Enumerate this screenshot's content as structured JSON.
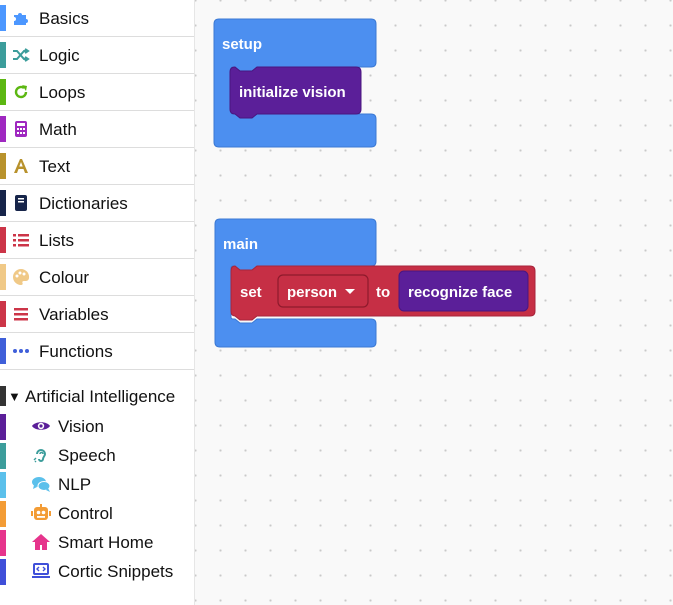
{
  "sidebar": {
    "categories": [
      {
        "label": "Basics",
        "icon": "puzzle-icon",
        "color": "#4c97ff"
      },
      {
        "label": "Logic",
        "icon": "shuffle-icon",
        "color": "#3c9d9b"
      },
      {
        "label": "Loops",
        "icon": "refresh-icon",
        "color": "#5cb712"
      },
      {
        "label": "Math",
        "icon": "calculator-icon",
        "color": "#9f28c0"
      },
      {
        "label": "Text",
        "icon": "font-icon",
        "color": "#b8922c"
      },
      {
        "label": "Dictionaries",
        "icon": "book-icon",
        "color": "#17254a"
      },
      {
        "label": "Lists",
        "icon": "list-icon",
        "color": "#cc3548"
      },
      {
        "label": "Colour",
        "icon": "palette-icon",
        "color": "#f0c987"
      },
      {
        "label": "Variables",
        "icon": "bars-icon",
        "color": "#cc3548"
      },
      {
        "label": "Functions",
        "icon": "ellipsis-icon",
        "color": "#3f5fd9"
      }
    ],
    "ai_section": {
      "label": "Artificial Intelligence",
      "expanded": true,
      "items": [
        {
          "label": "Vision",
          "icon": "eye-icon",
          "color": "#5b1f99"
        },
        {
          "label": "Speech",
          "icon": "ear-icon",
          "color": "#3c9d9b"
        },
        {
          "label": "NLP",
          "icon": "chat-bubbles-icon",
          "color": "#5bc0eb"
        },
        {
          "label": "Control",
          "icon": "robot-icon",
          "color": "#f39c35"
        },
        {
          "label": "Smart Home",
          "icon": "home-icon",
          "color": "#e6348c"
        },
        {
          "label": "Cortic Snippets",
          "icon": "laptop-code-icon",
          "color": "#3f4fd9"
        }
      ]
    }
  },
  "workspace": {
    "setup_block": {
      "label": "setup",
      "color": "#4c8ff0",
      "statement": {
        "label": "initialize vision",
        "color": "#5b1f99"
      }
    },
    "main_block": {
      "label": "main",
      "color": "#4c8ff0",
      "statement": {
        "set_label": "set",
        "variable": "person",
        "to_label": "to",
        "value_label": "recognize face",
        "color": "#c62f45",
        "value_color": "#5b1f99"
      }
    }
  }
}
